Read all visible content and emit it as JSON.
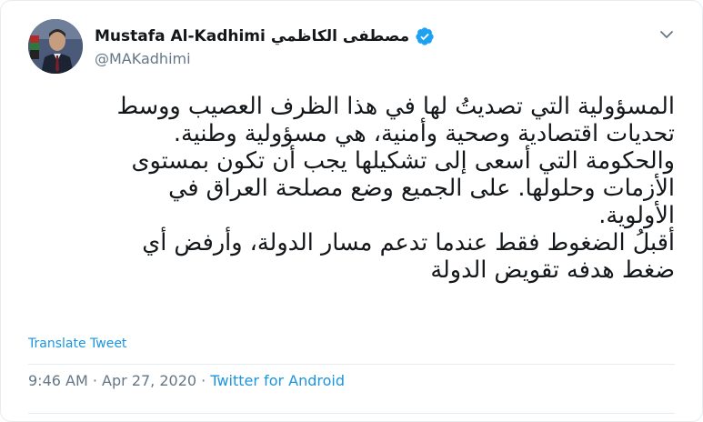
{
  "author": {
    "name": "Mustafa Al-Kadhimi",
    "name_arabic": "مصطفى الكاظمي",
    "handle": "@MAKadhimi"
  },
  "tweet": {
    "lines": [
      "المسؤولية التي تصديتُ لها في هذا الظرف العصيب ووسط",
      "تحديات اقتصادية وصحية وأمنية، هي مسؤولية وطنية.",
      "والحكومة التي أسعى إلى تشكيلها يجب أن تكون بمستوى",
      "الأزمات وحلولها. على الجميع وضع مصلحة العراق في",
      "الأولوية.",
      "أقبلُ الضغوط فقط عندما تدعم مسار الدولة، وأرفض أي",
      "ضغط هدفه تقويض الدولة"
    ]
  },
  "actions": {
    "translate_label": "Translate Tweet"
  },
  "meta": {
    "time": "9:46 AM",
    "separator": "·",
    "date": "Apr 27, 2020",
    "source": "Twitter for Android"
  },
  "colors": {
    "link": "#1b95e0",
    "verified": "#1da1f2",
    "secondary_text": "#657786"
  },
  "icons": {
    "verified": "verified-badge-icon",
    "caret": "chevron-down-icon"
  }
}
